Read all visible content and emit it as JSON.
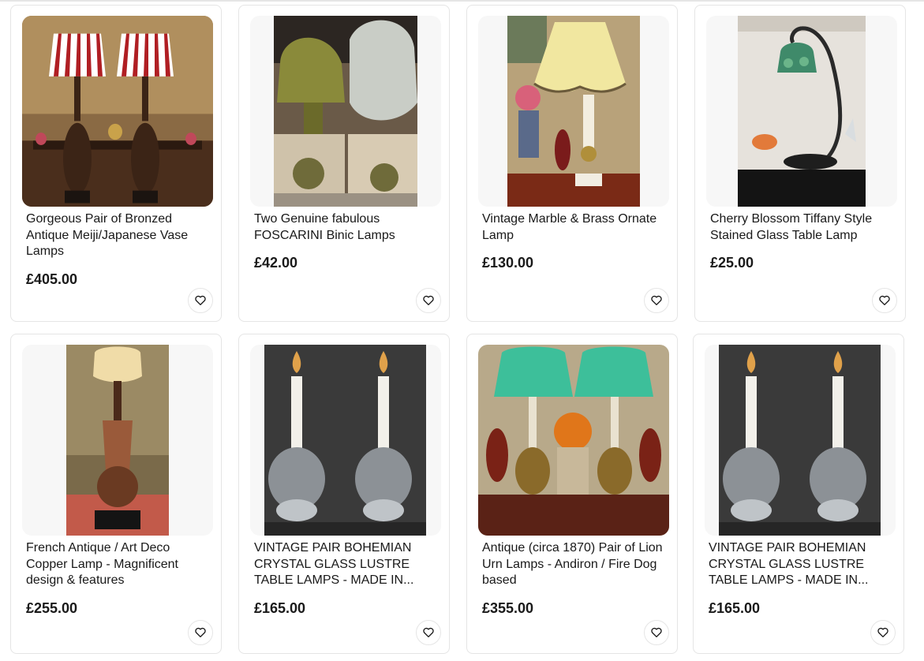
{
  "listings": [
    {
      "title": "Gorgeous Pair of Bronzed Antique Meiji/Japanese Vase Lamps",
      "price": "£405.00",
      "icon": "heart-icon"
    },
    {
      "title": "Two Genuine fabulous FOSCARINI Binic Lamps",
      "price": "£42.00",
      "icon": "heart-icon"
    },
    {
      "title": "Vintage Marble & Brass Ornate Lamp",
      "price": "£130.00",
      "icon": "heart-icon"
    },
    {
      "title": "Cherry Blossom Tiffany Style Stained Glass Table Lamp",
      "price": "£25.00",
      "icon": "heart-icon"
    },
    {
      "title": "French Antique / Art Deco Copper Lamp - Magnificent design & features",
      "price": "£255.00",
      "icon": "heart-icon"
    },
    {
      "title": "VINTAGE PAIR BOHEMIAN CRYSTAL GLASS LUSTRE TABLE LAMPS - MADE IN...",
      "price": "£165.00",
      "icon": "heart-icon"
    },
    {
      "title": "Antique (circa 1870) Pair of Lion Urn Lamps - Andiron / Fire Dog based",
      "price": "£355.00",
      "icon": "heart-icon"
    },
    {
      "title": "VINTAGE PAIR BOHEMIAN CRYSTAL GLASS LUSTRE TABLE LAMPS - MADE IN...",
      "price": "£165.00",
      "icon": "heart-icon"
    }
  ]
}
